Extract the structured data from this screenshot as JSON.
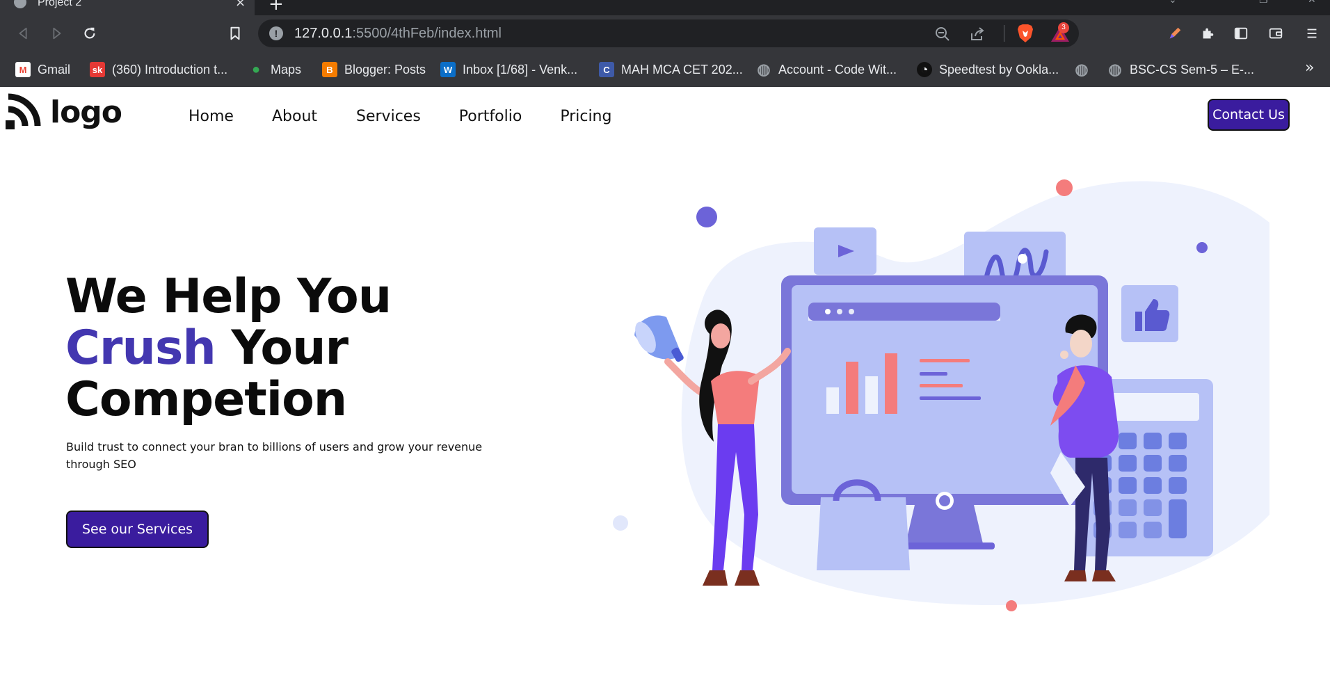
{
  "browser": {
    "tab_title": "Project 2",
    "tab_close": "×",
    "new_tab": "+",
    "url_host": "127.0.0.1",
    "url_rest": ":5500/4thFeb/index.html",
    "bat_badge": "3",
    "bookmarks": [
      {
        "label": "Gmail",
        "icon": "gmail-icon",
        "color": "#ea4335",
        "glyph": "M"
      },
      {
        "label": "(360) Introduction t...",
        "icon": "youtube-icon",
        "color": "#e53935",
        "glyph": "sk"
      },
      {
        "label": "Maps",
        "icon": "maps-icon",
        "color": "#34a853",
        "glyph": "●"
      },
      {
        "label": "Blogger: Posts",
        "icon": "blogger-icon",
        "color": "#f57c00",
        "glyph": "B"
      },
      {
        "label": "Inbox [1/68] - Venk...",
        "icon": "mail-icon",
        "color": "#0b6ec7",
        "glyph": "W"
      },
      {
        "label": "MAH MCA CET 202...",
        "icon": "c-icon",
        "color": "#3e5aa8",
        "glyph": "C"
      },
      {
        "label": "Account - Code Wit...",
        "icon": "globe-icon",
        "color": "#9aa0a6",
        "glyph": "◍"
      },
      {
        "label": "Speedtest by Ookla...",
        "icon": "speedtest-icon",
        "color": "#111111",
        "glyph": "◔"
      },
      {
        "label": "",
        "icon": "globe-icon",
        "color": "#9aa0a6",
        "glyph": "◍"
      },
      {
        "label": "BSC-CS Sem-5 – E-...",
        "icon": "globe-icon",
        "color": "#9aa0a6",
        "glyph": "◍"
      }
    ],
    "bookmarks_more": "»"
  },
  "site": {
    "logo_text": "logo",
    "nav": [
      "Home",
      "About",
      "Services",
      "Portfolio",
      "Pricing"
    ],
    "contact_button": "Contact Us",
    "hero": {
      "line1": "We Help You",
      "line2_accent": "Crush",
      "line2_rest": " Your",
      "line3": "Competion",
      "subtitle": "Build trust to connect your bran to billions of users and grow your revenue through SEO",
      "cta": "See our Services"
    },
    "colors": {
      "accent": "#4337b0",
      "button": "#3a1c9e",
      "illustration_purple": "#6c63d8",
      "illustration_coral": "#f07b7b"
    }
  }
}
